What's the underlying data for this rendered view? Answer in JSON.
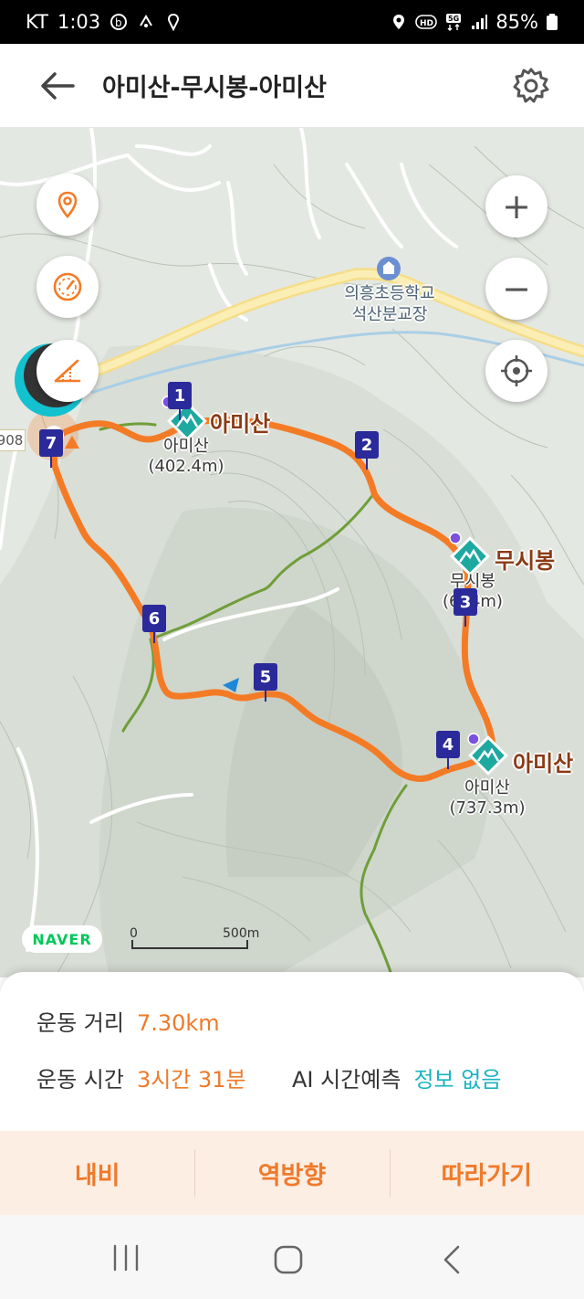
{
  "status_bar": {
    "carrier": "KT",
    "time": "1:03",
    "battery": "85%",
    "left_icons": [
      "b-app-icon",
      "nfc-icon",
      "location-arrow-icon"
    ],
    "right_icons": [
      "location-icon",
      "hd-icon",
      "5g-icon",
      "signal-icon",
      "battery-icon"
    ]
  },
  "app_bar": {
    "title": "아미산-무시봉-아미산",
    "back_icon": "back-arrow-icon",
    "settings_icon": "gear-icon"
  },
  "map": {
    "peaks": [
      {
        "name": "아미산",
        "elevation": "(402.4m)"
      },
      {
        "name": "무시봉",
        "sub_name": "무시봉",
        "elevation": "(6  .4m)"
      },
      {
        "name": "아미산",
        "sub_name": "아미산",
        "elevation": "(737.3m)"
      }
    ],
    "school": {
      "line1": "의흥초등학교",
      "line2": "석산분교장"
    },
    "road_number": "908",
    "waypoints": [
      "1",
      "2",
      "3",
      "4",
      "5",
      "6",
      "7"
    ],
    "scale_zero": "0",
    "scale_length": "500m",
    "provider": "NAVER",
    "controls": {
      "zoom_in": "+",
      "zoom_out": "−"
    },
    "route_color": "#f47b26",
    "trail_color": "#6f9e3a"
  },
  "summary": {
    "distance_label": "운동 거리",
    "distance_value": "7.30km",
    "time_label": "운동 시간",
    "time_value": "3시간 31분",
    "ai_label": "AI 시간예측",
    "ai_value": "정보 없음"
  },
  "actions": {
    "navigate": "내비",
    "reverse": "역방향",
    "follow": "따라가기"
  },
  "colors": {
    "accent": "#ef7a2a",
    "teal": "#1bb3c2",
    "action_bg": "#fdeee4",
    "waypoint": "#2b2a9a"
  }
}
